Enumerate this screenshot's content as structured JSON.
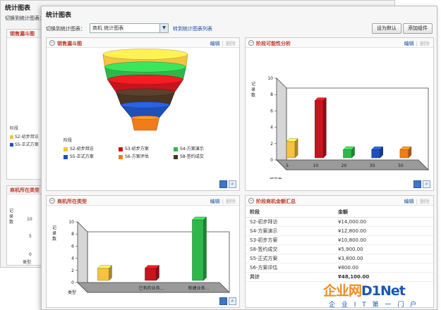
{
  "back_window": {
    "title": "统计图表",
    "switch_text": "切换到统计图表：",
    "funnel_title": "销售漏斗图",
    "type_title": "商机所在类型",
    "legend_title": "阶段",
    "legend_items": [
      {
        "label": "S2-初步拜访",
        "color": "#f5c242"
      },
      {
        "label": "S5-正式方案",
        "color": "#1f4fb8"
      }
    ],
    "y_label": "记录数",
    "y_ticks": [
      "10",
      "5",
      "0"
    ],
    "x_label": "类型"
  },
  "window": {
    "title": "统计图表",
    "switch_label": "切换到统计图表：",
    "select_value": "商机 统计图表",
    "goto_link": "转到统计图表列表",
    "btn_default": "设为默认",
    "btn_add": "添加组件"
  },
  "panels": {
    "funnel": {
      "title": "销售漏斗图",
      "edit": "编辑",
      "sep": "|",
      "del": "删除",
      "legend_title": "阶段",
      "legend": [
        {
          "label": "S2-初步拜访",
          "color": "#f5c242"
        },
        {
          "label": "S3-初步方案",
          "color": "#c4161c"
        },
        {
          "label": "S4-方案演示",
          "color": "#2fb84a"
        },
        {
          "label": "S5-正式方案",
          "color": "#1f4fb8"
        },
        {
          "label": "S6-方案评估",
          "color": "#f07d1a"
        },
        {
          "label": "S8-签约成交",
          "color": "#4a3424"
        }
      ]
    },
    "probability": {
      "title": "阶段可能性分析",
      "edit": "编辑",
      "sep": "|",
      "del": "删除"
    },
    "type": {
      "title": "商机所在类型",
      "edit": "编辑",
      "sep": "|",
      "del": "删除"
    },
    "amount": {
      "title": "阶段商机金额汇总",
      "edit": "编辑",
      "sep": "|",
      "del": "删除",
      "col_stage": "阶段",
      "col_amount": "金额",
      "rows": [
        {
          "stage": "S2-初步拜访",
          "amount": "¥14,000.00"
        },
        {
          "stage": "S4-方案演示",
          "amount": "¥12,800.00"
        },
        {
          "stage": "S3-初步方案",
          "amount": "¥10,800.00"
        },
        {
          "stage": "S8-签约成交",
          "amount": "¥5,900.00"
        },
        {
          "stage": "S5-正式方案",
          "amount": "¥3,800.00"
        },
        {
          "stage": "S6-方案评估",
          "amount": "¥800.00"
        }
      ],
      "total_label": "共计",
      "total_value": "¥48,100.00"
    }
  },
  "chart_data": [
    {
      "type": "funnel",
      "title": "销售漏斗图",
      "legend_title": "阶段",
      "categories": [
        "S2-初步拜访",
        "S4-方案演示",
        "S3-初步方案",
        "S8-签约成交",
        "S5-正式方案",
        "S6-方案评估"
      ],
      "colors": [
        "#f5c242",
        "#2fb84a",
        "#c4161c",
        "#4a3424",
        "#1f4fb8",
        "#f07d1a"
      ],
      "values": [
        14000,
        12800,
        10800,
        5900,
        3800,
        800
      ]
    },
    {
      "type": "bar",
      "title": "阶段可能性分析",
      "xlabel": "可能性",
      "ylabel": "记录数",
      "categories": [
        "5",
        "10",
        "20",
        "30",
        "50"
      ],
      "values": [
        2,
        7,
        1,
        1,
        1
      ],
      "colors": [
        "#f5c242",
        "#c4161c",
        "#2fb84a",
        "#1f4fb8",
        "#f07d1a"
      ],
      "ylim": [
        0,
        10
      ],
      "yticks": [
        0,
        2,
        4,
        6,
        8,
        10
      ]
    },
    {
      "type": "bar",
      "title": "商机所在类型",
      "xlabel": "类型",
      "ylabel": "记录数",
      "categories": [
        "",
        "已有的业务...",
        "新建业务..."
      ],
      "values": [
        2,
        2,
        10
      ],
      "colors": [
        "#f5c242",
        "#c4161c",
        "#2fb84a"
      ],
      "ylim": [
        0,
        10
      ],
      "yticks": [
        0,
        2,
        4,
        6,
        8,
        10
      ]
    }
  ],
  "watermark": {
    "logo_a": "企业网",
    "logo_b": "D1Net",
    "sub": "企 业 I T 第 一 门 户"
  },
  "icons": {
    "panel": "collapse-circle-icon",
    "chart_tool": "chart-view-icon",
    "zoom_tool": "zoom-icon"
  }
}
